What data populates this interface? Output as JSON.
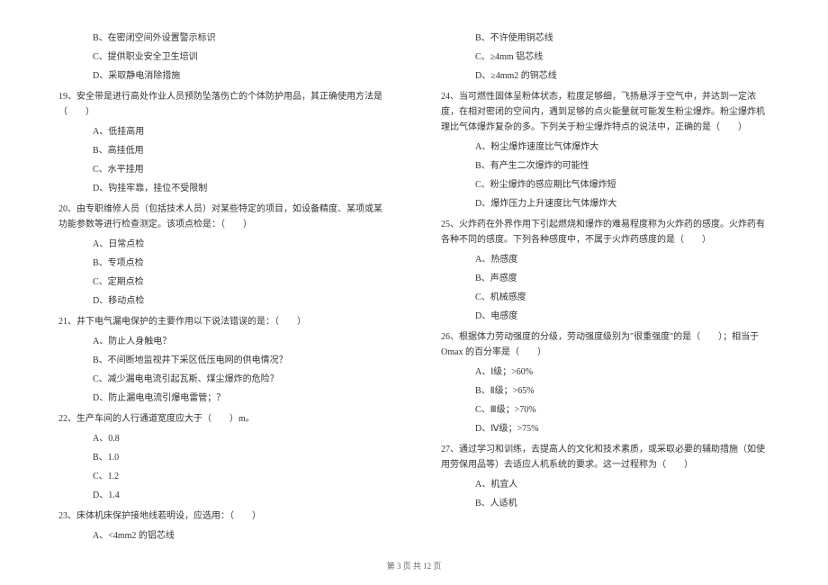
{
  "left_column": {
    "q18_options": [
      "B、在密闭空间外设置警示标识",
      "C、提供职业安全卫生培训",
      "D、采取静电消除措施"
    ],
    "q19": {
      "stem": "19、安全带是进行高处作业人员预防坠落伤亡的个体防护用品，其正确使用方法是（　　）",
      "options": [
        "A、低挂高用",
        "B、高挂低用",
        "C、水平挂用",
        "D、钩挂牢靠，挂位不受限制"
      ]
    },
    "q20": {
      "stem": "20、由专职维修人员（包括技术人员）对某些特定的项目，如设备精度、某项或某功能参数等进行检查测定。该项点检是：（　　）",
      "options": [
        "A、日常点检",
        "B、专项点检",
        "C、定期点检",
        "D、移动点检"
      ]
    },
    "q21": {
      "stem": "21、井下电气漏电保护的主要作用以下说法错误的是：（　　）",
      "options": [
        "A、防止人身触电？",
        "B、不间断地监视井下采区低压电网的供电情况？",
        "C、减少漏电电流引起瓦斯、煤尘爆炸的危险？",
        "D、防止漏电电流引爆电雷管；？"
      ]
    },
    "q22": {
      "stem": "22、生产车间的人行通道宽度应大于（　　）m。",
      "options": [
        "A、0.8",
        "B、1.0",
        "C、1.2",
        "D、1.4"
      ]
    },
    "q23": {
      "stem": "23、床体机床保护接地线若明设，应选用：（　　）",
      "options": [
        "A、<4mm2 的铝芯线"
      ]
    }
  },
  "right_column": {
    "q23_options": [
      "B、不许使用铜芯线",
      "C、≥4mm 铝芯线",
      "D、≥4mm2 的铜芯线"
    ],
    "q24": {
      "stem": "24、当可燃性固体呈粉体状态，粒度足够细，飞扬悬浮于空气中，并达到一定浓度，在相对密闭的空间内，遇到足够的点火能量就可能发生粉尘爆炸。粉尘爆炸机理比气体爆炸复杂的多。下列关于粉尘爆炸特点的说法中，正确的是（　　）",
      "options": [
        "A、粉尘爆炸速度比气体爆炸大",
        "B、有产生二次爆炸的可能性",
        "C、粉尘爆炸的感应期比气体爆炸短",
        "D、爆炸压力上升速度比气体爆炸大"
      ]
    },
    "q25": {
      "stem": "25、火炸药在外界作用下引起燃烧和爆炸的难易程度称为火炸药的感度。火炸药有各种不同的感度。下列各种感度中，不属于火炸药感度的是（　　）",
      "options": [
        "A、热感度",
        "B、声感度",
        "C、机械感度",
        "D、电感度"
      ]
    },
    "q26": {
      "stem": "26、根据体力劳动强度的分级，劳动强度级别为\"很重强度\"的是（　　）；相当于 Omax 的百分率是（　　）",
      "options": [
        "A、Ⅰ级；>60%",
        "B、Ⅱ级；>65%",
        "C、Ⅲ级；>70%",
        "D、Ⅳ级；>75%"
      ]
    },
    "q27": {
      "stem": "27、通过学习和训练，去提高人的文化和技术素质，或采取必要的辅助措施（如使用劳保用品等）去适应人机系统的要求。这一过程称为（　　）",
      "options": [
        "A、机宜人",
        "B、人适机"
      ]
    }
  },
  "footer": "第 3 页 共 12 页"
}
